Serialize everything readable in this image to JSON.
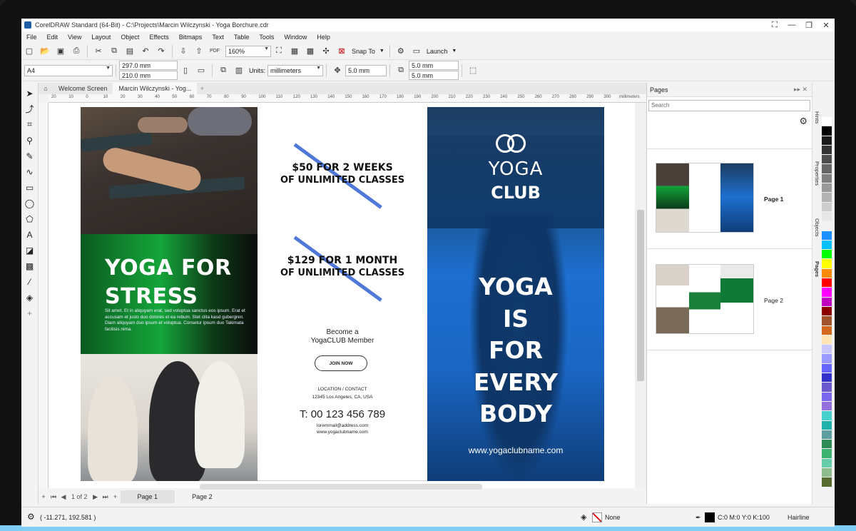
{
  "window": {
    "title": "CorelDRAW Standard (64-Bit) - C:\\Projects\\Marcin Wilczynski - Yoga Borchure.cdr",
    "controls": [
      "⛶",
      "—",
      "❐",
      "✕"
    ]
  },
  "menu": [
    "File",
    "Edit",
    "View",
    "Layout",
    "Object",
    "Effects",
    "Bitmaps",
    "Text",
    "Table",
    "Tools",
    "Window",
    "Help"
  ],
  "toolbar1": {
    "zoom": "160%",
    "snap_to": "Snap To",
    "launch": "Launch"
  },
  "toolbar2": {
    "page_size": "A4",
    "width": "297.0 mm",
    "height": "210.0 mm",
    "units_label": "Units:",
    "units": "millimeters",
    "nudge": "5.0 mm",
    "dup_x": "5.0 mm",
    "dup_y": "5.0 mm"
  },
  "doc_tabs": [
    "Welcome Screen",
    "Marcin Wilczynski - Yog..."
  ],
  "ruler": {
    "ticks": [
      "20",
      "10",
      "0",
      "10",
      "20",
      "30",
      "40",
      "50",
      "60",
      "70",
      "80",
      "90",
      "100",
      "110",
      "120",
      "130",
      "140",
      "150",
      "160",
      "170",
      "180",
      "190",
      "200",
      "210",
      "220",
      "230",
      "240",
      "250",
      "260",
      "270",
      "280",
      "290",
      "300"
    ],
    "unit": "millimeters"
  },
  "brochure": {
    "left": {
      "headline1": "YOGA FOR",
      "headline2": "STRESS",
      "body": "Sit amet. Et in aliquyam erat, sed voluptua sanctus eos ipsum. Erat et accusam et justo duo dolores et ea rebum. Stet clita kasd gubergren. Diam aliquyam duo ipsum et voluptua. Consetur ipsum duo Takimata facilisis nima."
    },
    "middle": {
      "offer1_a": "$50 FOR 2 WEEKS",
      "offer1_b": "OF UNLIMITED CLASSES",
      "offer2_a": "$129 FOR 1 MONTH",
      "offer2_b": "OF UNLIMITED CLASSES",
      "become1": "Become a",
      "become2": "YogaCLUB Member",
      "join": "JOIN NOW",
      "location_label": "LOCATION / CONTACT",
      "address": "12345 Los Angeles, CA, USA",
      "phone": "T: 00 123 456 789",
      "email": "loremmail@address.com",
      "web": "www.yogaclubname.com"
    },
    "right": {
      "yoga": "YOGA",
      "club": "CLUB",
      "slogan": [
        "YOGA",
        "IS",
        "FOR",
        "EVERY",
        "BODY"
      ],
      "url": "www.yogaclubname.com"
    }
  },
  "pages_panel": {
    "title": "Pages",
    "search_placeholder": "Search",
    "page1": "Page 1",
    "page2": "Page 2"
  },
  "side_tabs": [
    "Hints",
    "Properties",
    "Objects",
    "Pages"
  ],
  "palette": [
    "#ffffff",
    "#000000",
    "#1a1a1a",
    "#333333",
    "#4d4d4d",
    "#666666",
    "#808080",
    "#999999",
    "#b3b3b3",
    "#cccccc",
    "#e6e6e6",
    "#f2f2f2",
    "#1e90ff",
    "#00c0ff",
    "#00ff00",
    "#ffff00",
    "#ff8c00",
    "#ff0000",
    "#ff00ff",
    "#c000c0",
    "#8b0000",
    "#a0522d",
    "#d2691e",
    "#ffe4b5",
    "#c8c8ff",
    "#9999ff",
    "#6666ff",
    "#3333cc",
    "#6a5acd",
    "#7b68ee",
    "#9370db",
    "#48d1cc",
    "#20b2aa",
    "#5f9ea0",
    "#2e8b57",
    "#3cb371",
    "#66cdaa",
    "#8fbc8f",
    "#556b2f"
  ],
  "page_nav": {
    "counter": "1 of 2",
    "tab1": "Page 1",
    "tab2": "Page 2"
  },
  "status": {
    "coords": "( -11.271, 192.581 )",
    "fill": "None",
    "outline_color": "C:0 M:0 Y:0 K:100",
    "outline_width": "Hairline"
  }
}
